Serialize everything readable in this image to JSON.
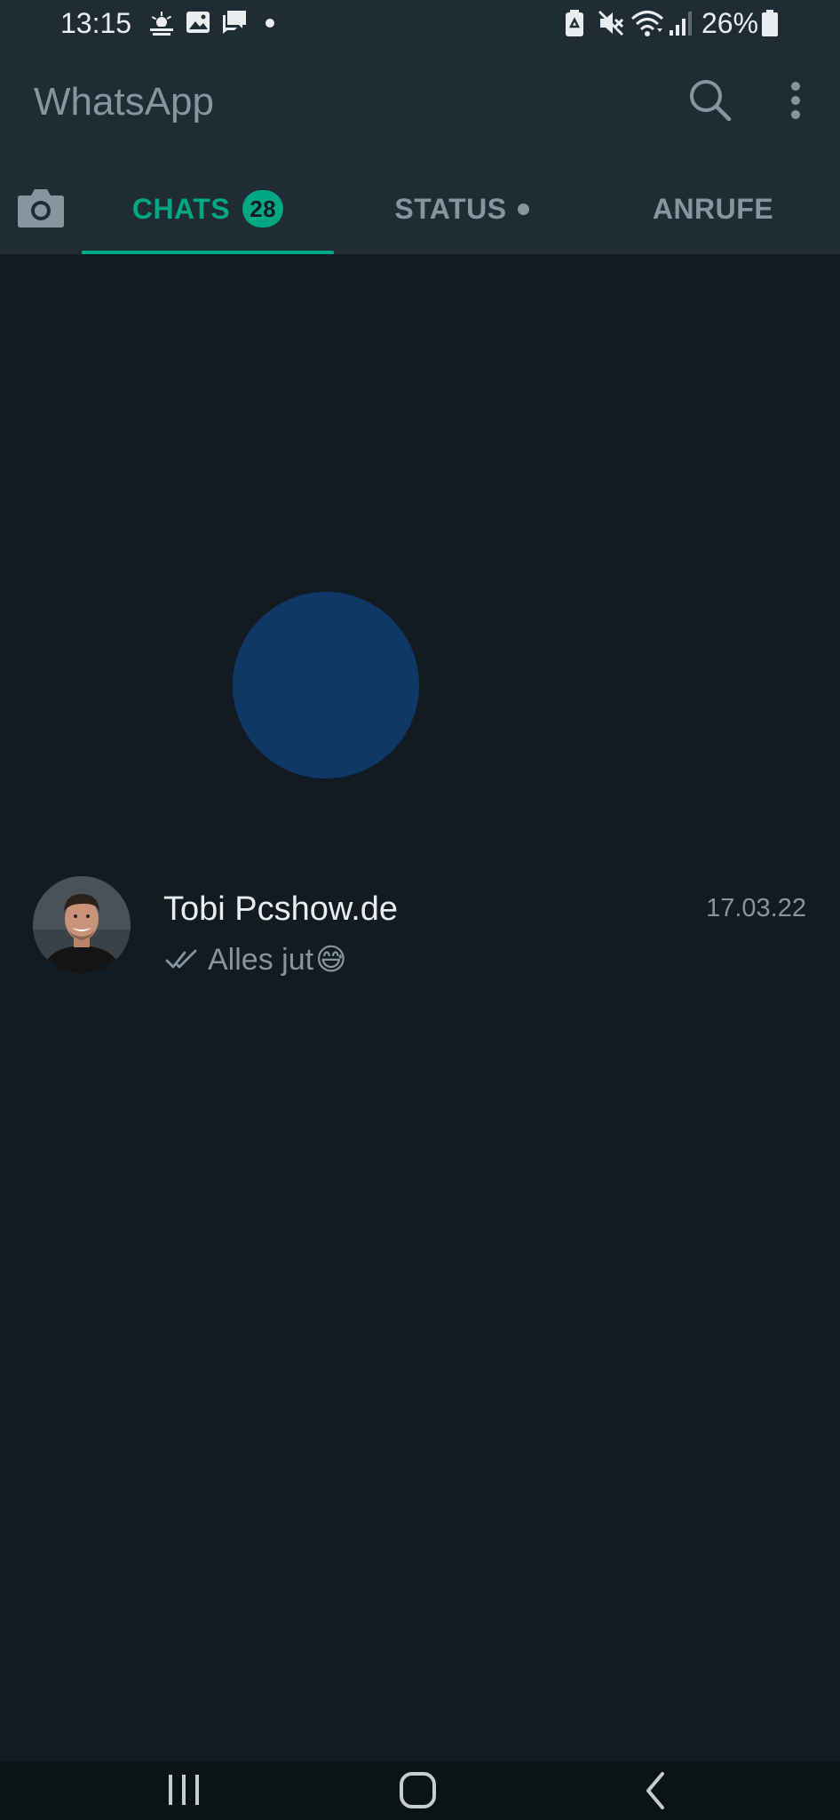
{
  "status_bar": {
    "time": "13:15",
    "battery_percent": "26%",
    "left_icons": [
      "weather-icon",
      "gallery-icon",
      "message-icon",
      "dot-icon"
    ],
    "right_icons": [
      "battery-saver-icon",
      "mute-icon",
      "wifi-icon",
      "signal-icon",
      "battery-icon"
    ]
  },
  "app_bar": {
    "title": "WhatsApp",
    "icons": [
      "search-icon",
      "more-vert-icon"
    ]
  },
  "tabs": {
    "camera_icon": "camera-icon",
    "items": [
      {
        "label": "CHATS",
        "badge": "28",
        "active": true
      },
      {
        "label": "STATUS",
        "has_dot": true,
        "active": false
      },
      {
        "label": "ANRUFE",
        "active": false
      }
    ]
  },
  "chats": [
    {
      "name": "Tobi Pcshow.de",
      "time": "17.03.22",
      "preview": "Alles jut",
      "emoji": "😅",
      "read_receipt": "double-check-icon"
    }
  ],
  "colors": {
    "accent": "#00a884",
    "app_bar_bg": "#1f2c34",
    "list_bg": "#121b22",
    "secondary_text": "#8696a0",
    "primary_text": "#e9edef",
    "touch_ripple": "#0d50a0"
  },
  "nav_bar": {
    "icons": [
      "recents-icon",
      "home-icon",
      "back-icon"
    ]
  }
}
